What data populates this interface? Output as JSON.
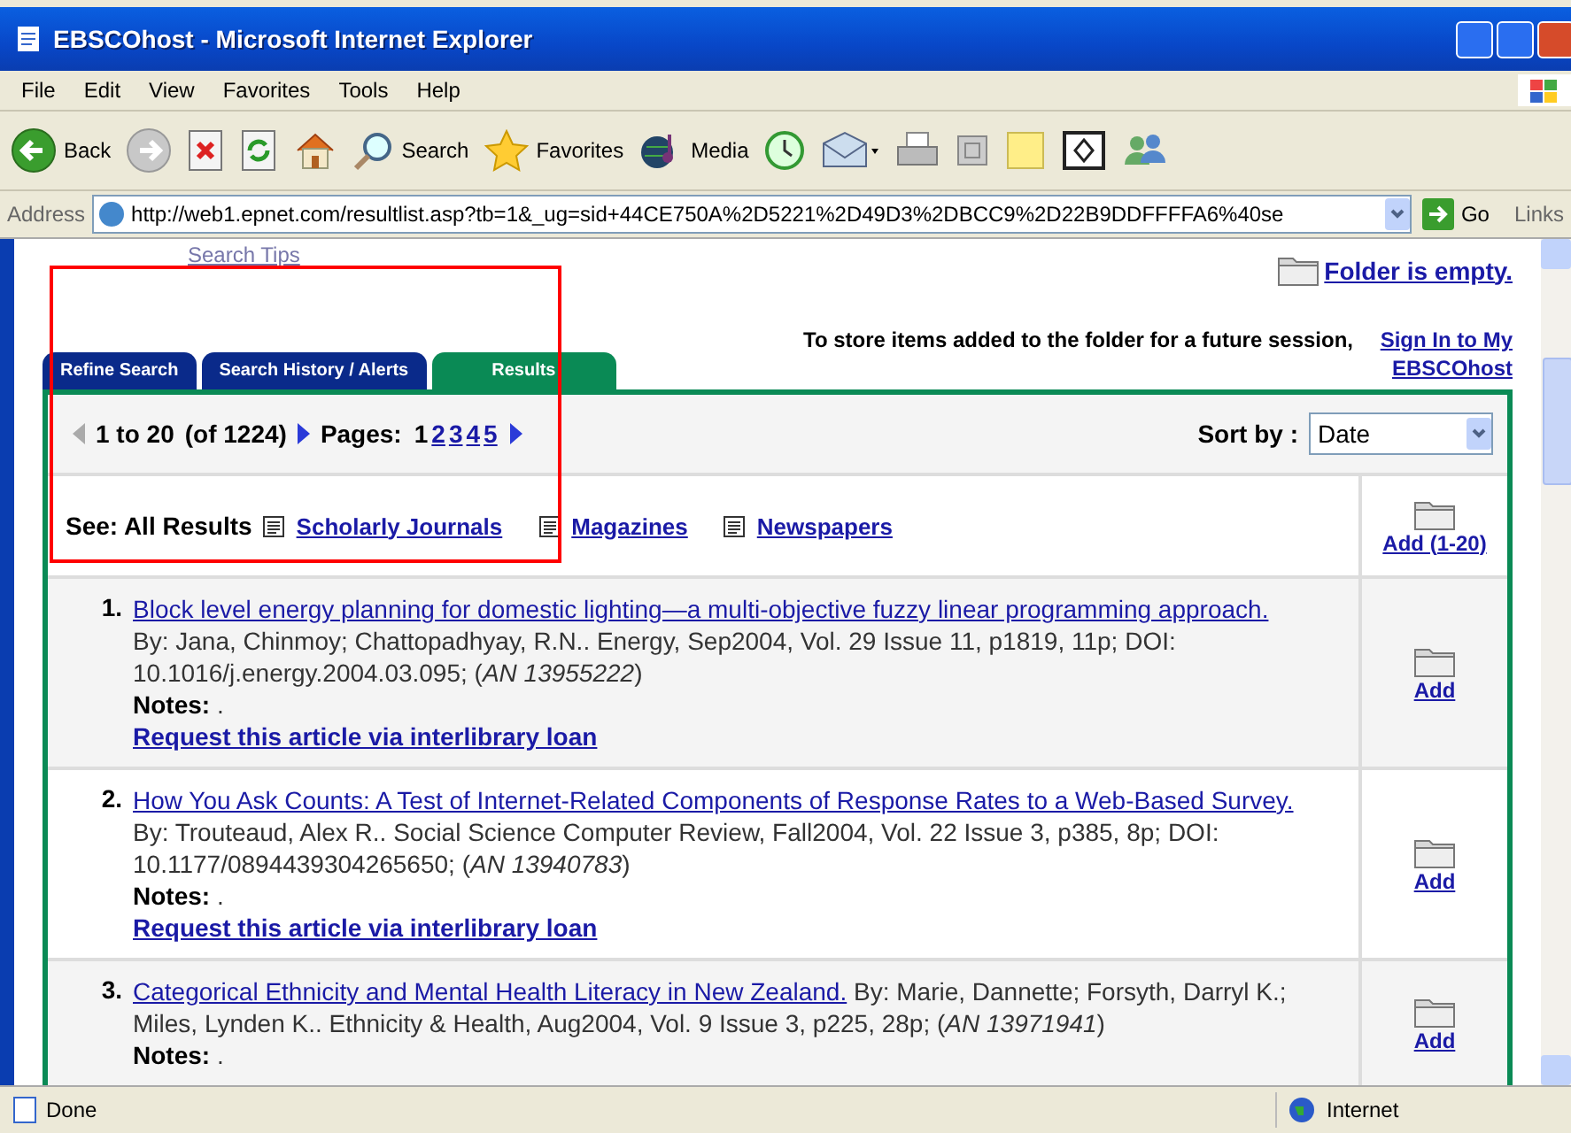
{
  "window": {
    "title": "EBSCOhost - Microsoft Internet Explorer"
  },
  "menu": [
    "File",
    "Edit",
    "View",
    "Favorites",
    "Tools",
    "Help"
  ],
  "toolbar": [
    {
      "kind": "back",
      "label": "Back"
    },
    {
      "kind": "forward"
    },
    {
      "kind": "stop"
    },
    {
      "kind": "refresh"
    },
    {
      "kind": "home"
    },
    {
      "kind": "search",
      "label": "Search"
    },
    {
      "kind": "favorites",
      "label": "Favorites"
    },
    {
      "kind": "media",
      "label": "Media"
    },
    {
      "kind": "history"
    },
    {
      "kind": "mail"
    },
    {
      "kind": "print"
    },
    {
      "kind": "edit"
    },
    {
      "kind": "note"
    },
    {
      "kind": "frame"
    },
    {
      "kind": "people"
    }
  ],
  "address": {
    "label": "Address",
    "value": "http://web1.epnet.com/resultlist.asp?tb=1&_ug=sid+44CE750A%2D5221%2D49D3%2DBCC9%2D22B9DDFFFFA6%40se",
    "go": "Go",
    "links": "Links"
  },
  "page": {
    "search_tips": "Search Tips",
    "folder_status": "Folder is empty.",
    "store_notice": "To store items added to the folder for a future session,",
    "sign_in": "Sign In to My EBSCOhost",
    "tabs": [
      {
        "label": "Refine Search",
        "selected": false
      },
      {
        "label": "Search History / Alerts",
        "selected": false
      },
      {
        "label": "Results",
        "selected": true
      }
    ],
    "pagination": {
      "range": "1 to 20",
      "total": "(of 1224)",
      "pages_label": "Pages:",
      "pages": [
        {
          "label": "1",
          "selected": true
        },
        {
          "label": "2",
          "selected": false
        },
        {
          "label": "3",
          "selected": false
        },
        {
          "label": "4",
          "selected": false
        },
        {
          "label": "5",
          "selected": false
        }
      ]
    },
    "sort": {
      "label": "Sort by :",
      "value": "Date"
    },
    "filters": {
      "label": "See: All Results",
      "links": [
        "Scholarly Journals",
        "Magazines",
        "Newspapers"
      ]
    },
    "add_all": "Add (1-20)",
    "results": [
      {
        "number": "1.",
        "title": "Block level energy planning for domestic lighting—a multi-objective fuzzy linear programming approach.",
        "citation": "By: Jana, Chinmoy; Chattopadhyay, R.N.. Energy, Sep2004, Vol. 29 Issue 11, p1819, 11p; DOI: 10.1016/j.energy.2004.03.095; (*AN 13955222*)",
        "notes_label": "Notes:",
        "notes": ".",
        "loan_link": "Request this article via interlibrary loan",
        "add": "Add"
      },
      {
        "number": "2.",
        "title": "How You Ask Counts: A Test of Internet-Related Components of Response Rates to a Web-Based Survey.",
        "citation": "By: Trouteaud, Alex R.. Social Science Computer Review, Fall2004, Vol. 22 Issue 3, p385, 8p; DOI: 10.1177/0894439304265650; (*AN 13940783*)",
        "notes_label": "Notes:",
        "notes": ".",
        "loan_link": "Request this article via interlibrary loan",
        "add": "Add"
      },
      {
        "number": "3.",
        "title": "Categorical Ethnicity and Mental Health Literacy in New Zealand.",
        "citation": "By: Marie, Dannette; Forsyth, Darryl K.; Miles, Lynden K.. Ethnicity & Health, Aug2004, Vol. 9 Issue 3, p225, 28p; (*AN 13971941*)",
        "notes_label": "Notes:",
        "notes": ".",
        "add": "Add"
      }
    ]
  },
  "status_bar": {
    "text": "Done",
    "zone": "Internet"
  }
}
